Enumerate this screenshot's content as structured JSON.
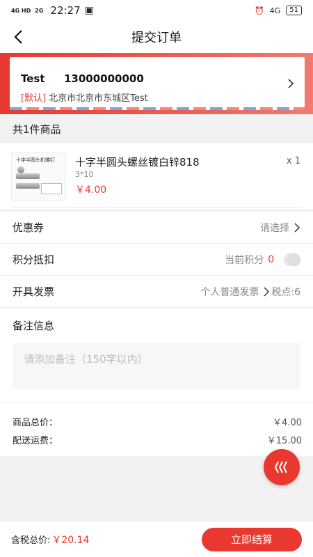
{
  "status_bar": {
    "signal1": "4G HD",
    "signal2": "2G",
    "time": "22:27",
    "right_network": "4G",
    "battery": "51"
  },
  "nav": {
    "title": "提交订单"
  },
  "address": {
    "name": "Test",
    "phone": "13000000000",
    "default_tag": "[默认]",
    "detail": "北京市北京市东城区Test"
  },
  "goods_section": {
    "count_label": "共1件商品"
  },
  "goods": {
    "image_caption": "十字半圆头机螺钉",
    "name": "十字半圆头螺丝镀白锌818",
    "spec": "3*10",
    "price": "￥4.00",
    "quantity": "x 1"
  },
  "coupon": {
    "label": "优惠券",
    "value": "请选择"
  },
  "points": {
    "label": "积分抵扣",
    "value_prefix": "当前积分",
    "value": "0",
    "toggle_on": false
  },
  "invoice": {
    "label": "开具发票",
    "value": "个人普通发票",
    "tax": "税点:6"
  },
  "remark": {
    "label": "备注信息",
    "placeholder": "请添加备注（150字以内）"
  },
  "totals": {
    "goods_total_label": "商品总价：",
    "goods_total": "￥4.00",
    "shipping_label": "配送运费：",
    "shipping": "￥15.00"
  },
  "footer": {
    "total_label": "含税总价:",
    "total": "￥20.14",
    "submit_label": "立即结算"
  },
  "colors": {
    "accent": "#e8382f"
  }
}
